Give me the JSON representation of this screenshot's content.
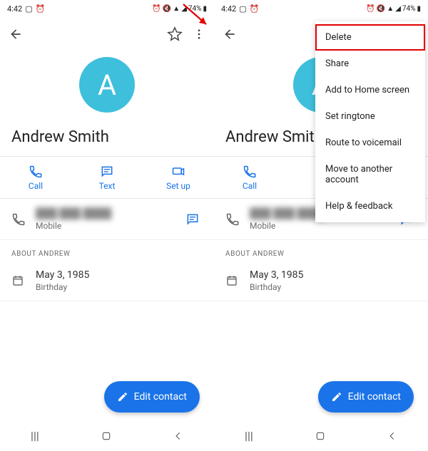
{
  "status": {
    "time": "4:42",
    "battery": "74%"
  },
  "contact": {
    "name": "Andrew Smith",
    "initial": "A",
    "phone_type": "Mobile",
    "about_label": "ABOUT ANDREW",
    "birthday_date": "May 3, 1985",
    "birthday_label": "Birthday"
  },
  "actions": {
    "call": "Call",
    "text": "Text",
    "setup": "Set up"
  },
  "fab": "Edit contact",
  "menu": {
    "delete": "Delete",
    "share": "Share",
    "addhome": "Add to Home screen",
    "ringtone": "Set ringtone",
    "voicemail": "Route to voicemail",
    "moveacct": "Move to another account",
    "help": "Help & feedback"
  }
}
